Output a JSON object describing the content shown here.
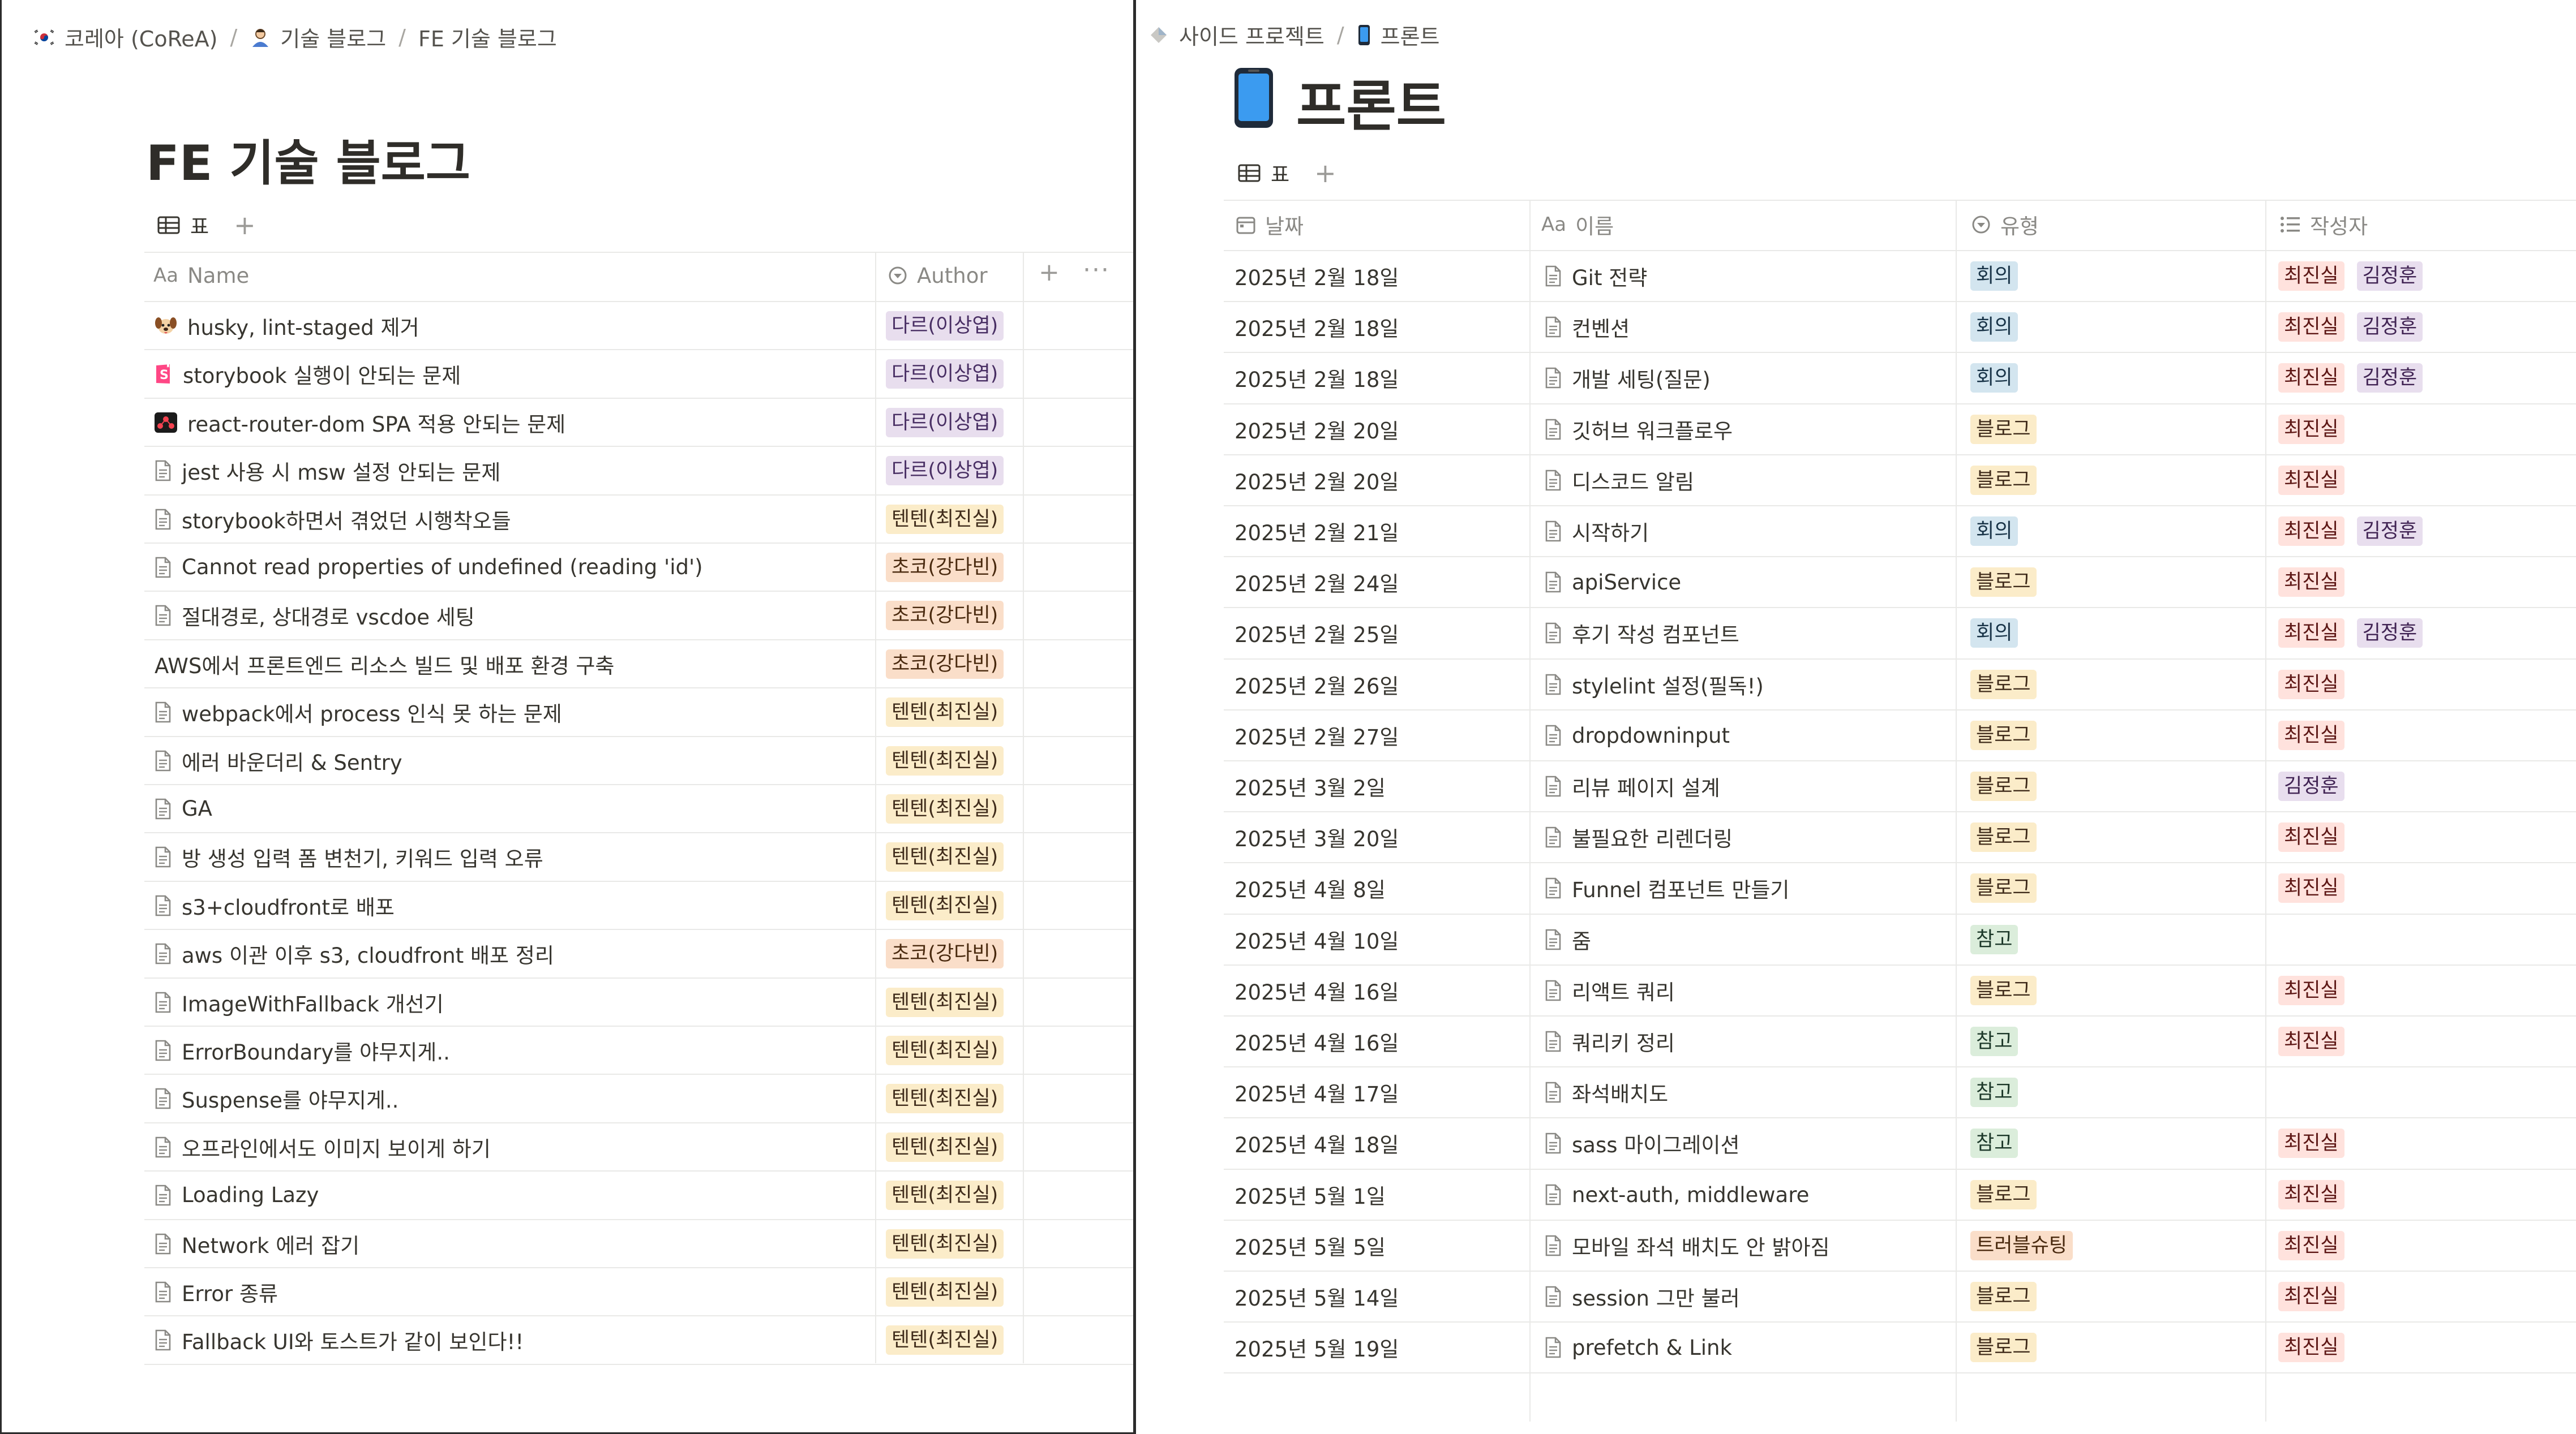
{
  "left": {
    "breadcrumb": [
      "코레아 (CoReA)",
      "기술 블로그",
      "FE 기술 블로그"
    ],
    "title": "FE 기술 블로그",
    "view_tab_label": "표",
    "columns": {
      "name": "Name",
      "author": "Author"
    },
    "rows": [
      {
        "icon": "dog-emoji-icon",
        "name": "husky, lint-staged 제거",
        "author": "다르(이상엽)",
        "color": "purple"
      },
      {
        "icon": "storybook-logo-icon",
        "name": "storybook 실행이 안되는 문제",
        "author": "다르(이상엽)",
        "color": "purple"
      },
      {
        "icon": "react-router-logo-icon",
        "name": "react-router-dom SPA 적용 안되는 문제",
        "author": "다르(이상엽)",
        "color": "purple"
      },
      {
        "icon": "page-icon",
        "name": "jest 사용 시 msw 설정 안되는 문제",
        "author": "다르(이상엽)",
        "color": "purple"
      },
      {
        "icon": "page-icon",
        "name": "storybook하면서 겪었던 시행착오들",
        "author": "텐텐(최진실)",
        "color": "yellow"
      },
      {
        "icon": "page-icon",
        "name": "Cannot read properties of undefined (reading 'id')",
        "author": "초코(강다빈)",
        "color": "orange"
      },
      {
        "icon": "page-icon",
        "name": "절대경로, 상대경로 vscdoe 세팅",
        "author": "초코(강다빈)",
        "color": "orange"
      },
      {
        "icon": "",
        "name": "AWS에서 프론트엔드 리소스 빌드 및 배포 환경 구축",
        "author": "초코(강다빈)",
        "color": "orange"
      },
      {
        "icon": "page-icon",
        "name": "webpack에서 process 인식 못 하는 문제",
        "author": "텐텐(최진실)",
        "color": "yellow"
      },
      {
        "icon": "page-icon",
        "name": "에러 바운더리 & Sentry",
        "author": "텐텐(최진실)",
        "color": "yellow"
      },
      {
        "icon": "page-icon",
        "name": "GA",
        "author": "텐텐(최진실)",
        "color": "yellow"
      },
      {
        "icon": "page-icon",
        "name": "방 생성 입력 폼 변천기, 키워드 입력 오류",
        "author": "텐텐(최진실)",
        "color": "yellow"
      },
      {
        "icon": "page-icon",
        "name": "s3+cloudfront로 배포",
        "author": "텐텐(최진실)",
        "color": "yellow"
      },
      {
        "icon": "page-icon",
        "name": "aws 이관 이후 s3, cloudfront 배포 정리",
        "author": "초코(강다빈)",
        "color": "orange"
      },
      {
        "icon": "page-icon",
        "name": "ImageWithFallback 개선기",
        "author": "텐텐(최진실)",
        "color": "yellow"
      },
      {
        "icon": "page-icon",
        "name": "ErrorBoundary를 야무지게..",
        "author": "텐텐(최진실)",
        "color": "yellow"
      },
      {
        "icon": "page-icon",
        "name": "Suspense를 야무지게..",
        "author": "텐텐(최진실)",
        "color": "yellow"
      },
      {
        "icon": "page-icon",
        "name": "오프라인에서도 이미지 보이게 하기",
        "author": "텐텐(최진실)",
        "color": "yellow"
      },
      {
        "icon": "page-icon",
        "name": "Loading Lazy",
        "author": "텐텐(최진실)",
        "color": "yellow"
      },
      {
        "icon": "page-icon",
        "name": "Network 에러 잡기",
        "author": "텐텐(최진실)",
        "color": "yellow"
      },
      {
        "icon": "page-icon",
        "name": "Error 종류",
        "author": "텐텐(최진실)",
        "color": "yellow"
      },
      {
        "icon": "page-icon",
        "name": "Fallback UI와 토스트가 같이 보인다!!",
        "author": "텐텐(최진실)",
        "color": "yellow"
      }
    ]
  },
  "right": {
    "breadcrumb": [
      "사이드 프로젝트",
      "프론트"
    ],
    "title": "프론트",
    "view_tab_label": "표",
    "columns": {
      "date": "날짜",
      "name": "이름",
      "type": "유형",
      "writer": "작성자"
    },
    "type_colors": {
      "회의": "blue",
      "블로그": "yellow",
      "참고": "green",
      "트러블슈팅": "orange"
    },
    "writer_colors": {
      "최진실": "red",
      "김정훈": "lavender"
    },
    "rows": [
      {
        "date": "2025년 2월 18일",
        "name": "Git 전략",
        "type": "회의",
        "writers": [
          "최진실",
          "김정훈"
        ]
      },
      {
        "date": "2025년 2월 18일",
        "name": "컨벤션",
        "type": "회의",
        "writers": [
          "최진실",
          "김정훈"
        ]
      },
      {
        "date": "2025년 2월 18일",
        "name": "개발 세팅(질문)",
        "type": "회의",
        "writers": [
          "최진실",
          "김정훈"
        ]
      },
      {
        "date": "2025년 2월 20일",
        "name": "깃허브 워크플로우",
        "type": "블로그",
        "writers": [
          "최진실"
        ]
      },
      {
        "date": "2025년 2월 20일",
        "name": "디스코드 알림",
        "type": "블로그",
        "writers": [
          "최진실"
        ]
      },
      {
        "date": "2025년 2월 21일",
        "name": "시작하기",
        "type": "회의",
        "writers": [
          "최진실",
          "김정훈"
        ]
      },
      {
        "date": "2025년 2월 24일",
        "name": "apiService",
        "type": "블로그",
        "writers": [
          "최진실"
        ]
      },
      {
        "date": "2025년 2월 25일",
        "name": "후기 작성 컴포넌트",
        "type": "회의",
        "writers": [
          "최진실",
          "김정훈"
        ]
      },
      {
        "date": "2025년 2월 26일",
        "name": "stylelint 설정(필독!)",
        "type": "블로그",
        "writers": [
          "최진실"
        ]
      },
      {
        "date": "2025년 2월 27일",
        "name": "dropdowninput",
        "type": "블로그",
        "writers": [
          "최진실"
        ]
      },
      {
        "date": "2025년 3월 2일",
        "name": "리뷰 페이지 설계",
        "type": "블로그",
        "writers": [
          "김정훈"
        ]
      },
      {
        "date": "2025년 3월 20일",
        "name": "불필요한 리렌더링",
        "type": "블로그",
        "writers": [
          "최진실"
        ]
      },
      {
        "date": "2025년 4월 8일",
        "name": "Funnel 컴포넌트 만들기",
        "type": "블로그",
        "writers": [
          "최진실"
        ]
      },
      {
        "date": "2025년 4월 10일",
        "name": "줌",
        "type": "참고",
        "writers": []
      },
      {
        "date": "2025년 4월 16일",
        "name": "리액트 쿼리",
        "type": "블로그",
        "writers": [
          "최진실"
        ]
      },
      {
        "date": "2025년 4월 16일",
        "name": "쿼리키 정리",
        "type": "참고",
        "writers": [
          "최진실"
        ]
      },
      {
        "date": "2025년 4월 17일",
        "name": "좌석배치도",
        "type": "참고",
        "writers": []
      },
      {
        "date": "2025년 4월 18일",
        "name": "sass 마이그레이션",
        "type": "참고",
        "writers": [
          "최진실"
        ]
      },
      {
        "date": "2025년 5월 1일",
        "name": "next-auth, middleware",
        "type": "블로그",
        "writers": [
          "최진실"
        ]
      },
      {
        "date": "2025년 5월 5일",
        "name": "모바일 좌석 배치도 안 밝아짐",
        "type": "트러블슈팅",
        "writers": [
          "최진실"
        ]
      },
      {
        "date": "2025년 5월 14일",
        "name": "session 그만 불러",
        "type": "블로그",
        "writers": [
          "최진실"
        ]
      },
      {
        "date": "2025년 5월 19일",
        "name": "prefetch & Link",
        "type": "블로그",
        "writers": [
          "최진실"
        ]
      }
    ]
  }
}
